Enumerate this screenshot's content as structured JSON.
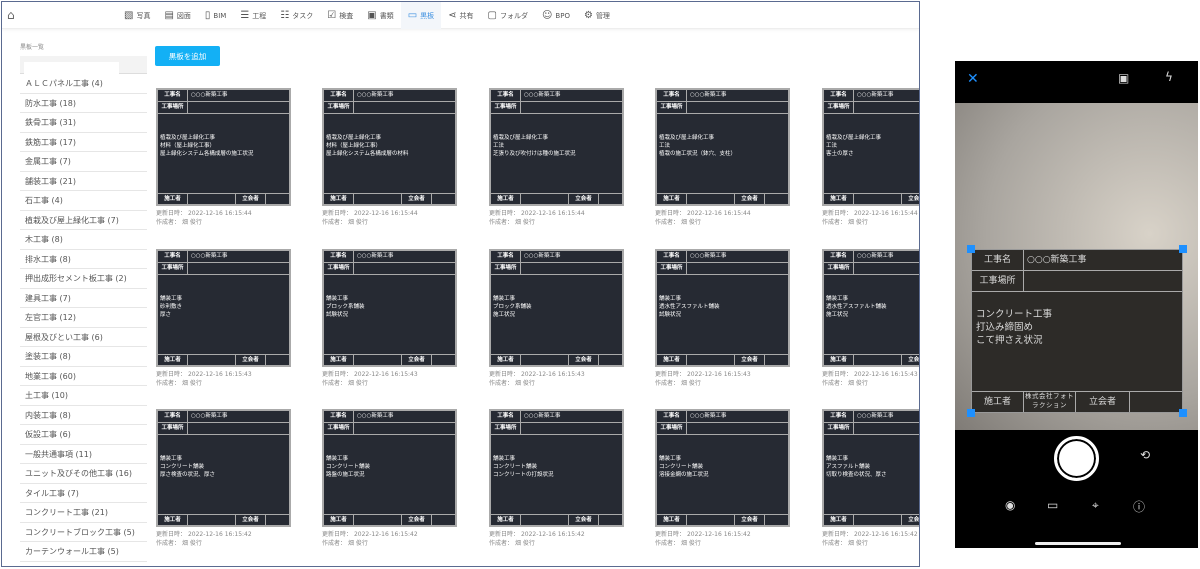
{
  "nav": {
    "home_icon": "home-icon",
    "items": [
      {
        "label": "写真",
        "icon": "image-icon"
      },
      {
        "label": "図面",
        "icon": "drawing-icon"
      },
      {
        "label": "BIM",
        "icon": "bim-icon"
      },
      {
        "label": "工程",
        "icon": "gantt-icon"
      },
      {
        "label": "タスク",
        "icon": "list-icon"
      },
      {
        "label": "検査",
        "icon": "clipboard-check-icon"
      },
      {
        "label": "書類",
        "icon": "document-icon"
      },
      {
        "label": "黒板",
        "icon": "board-icon",
        "active": true
      },
      {
        "label": "共有",
        "icon": "share-icon"
      },
      {
        "label": "フォルダ",
        "icon": "folder-icon"
      },
      {
        "label": "BPO",
        "icon": "users-icon"
      },
      {
        "label": "管理",
        "icon": "gear-icon"
      }
    ]
  },
  "sidebar": {
    "title": "黒板一覧",
    "search_value": "",
    "items": [
      "ＡＬＣパネル工事 (4)",
      "防水工事 (18)",
      "鉄骨工事 (31)",
      "鉄筋工事 (17)",
      "金属工事 (7)",
      "舗装工事 (21)",
      "石工事 (4)",
      "植栽及び屋上緑化工事 (7)",
      "木工事 (8)",
      "排水工事 (8)",
      "押出成形セメント板工事 (2)",
      "建具工事 (7)",
      "左官工事 (12)",
      "屋根及びとい工事 (6)",
      "塗装工事 (8)",
      "地業工事 (60)",
      "土工事 (10)",
      "内装工事 (8)",
      "仮設工事 (6)",
      "一般共通事項 (11)",
      "ユニット及びその他工事 (16)",
      "タイル工事 (7)",
      "コンクリート工事 (21)",
      "コンクリートブロック工事 (5)",
      "カーテンウォール工事 (5)"
    ]
  },
  "add_button": "黒板を追加",
  "board_labels": {
    "name": "工事名",
    "place": "工事場所",
    "builder": "施工者",
    "witness": "立会者",
    "updated": "更新日時：",
    "author": "作成者："
  },
  "cards": [
    {
      "name": "○○○新築工事",
      "lines": [
        "植栽及び屋上緑化工事",
        "材料（屋上緑化工事）",
        "屋上緑化システム各構成層の施工状況"
      ],
      "updated": "2022-12-16 16:15:44",
      "author": "畑 俊行"
    },
    {
      "name": "○○○新築工事",
      "lines": [
        "植栽及び屋上緑化工事",
        "材料（屋上緑化工事）",
        "屋上緑化システム各構成層の材料"
      ],
      "updated": "2022-12-16 16:15:44",
      "author": "畑 俊行"
    },
    {
      "name": "○○○新築工事",
      "lines": [
        "植栽及び屋上緑化工事",
        "工法",
        "芝張り及び吹付けは種の施工状況"
      ],
      "updated": "2022-12-16 16:15:44",
      "author": "畑 俊行"
    },
    {
      "name": "○○○新築工事",
      "lines": [
        "植栽及び屋上緑化工事",
        "工法",
        "植栽の施工状況（鉢穴、支柱）"
      ],
      "updated": "2022-12-16 16:15:44",
      "author": "畑 俊行"
    },
    {
      "name": "○○○新築工事",
      "lines": [
        "植栽及び屋上緑化工事",
        "工法",
        "客土の厚さ"
      ],
      "updated": "2022-12-16 16:15:44",
      "author": "畑 俊行"
    },
    {
      "name": "○○○新築工事",
      "lines": [
        "舗装工事",
        "砂利敷き",
        "厚さ"
      ],
      "updated": "2022-12-16 16:15:43",
      "author": "畑 俊行"
    },
    {
      "name": "○○○新築工事",
      "lines": [
        "舗装工事",
        "ブロック系舗装",
        "試験状況"
      ],
      "updated": "2022-12-16 16:15:43",
      "author": "畑 俊行"
    },
    {
      "name": "○○○新築工事",
      "lines": [
        "舗装工事",
        "ブロック系舗装",
        "施工状況"
      ],
      "updated": "2022-12-16 16:15:43",
      "author": "畑 俊行"
    },
    {
      "name": "○○○新築工事",
      "lines": [
        "舗装工事",
        "透水性アスファルト舗装",
        "試験状況"
      ],
      "updated": "2022-12-16 16:15:43",
      "author": "畑 俊行"
    },
    {
      "name": "○○○新築工事",
      "lines": [
        "舗装工事",
        "透水性アスファルト舗装",
        "施工状況"
      ],
      "updated": "2022-12-16 16:15:43",
      "author": "畑 俊行"
    },
    {
      "name": "○○○新築工事",
      "lines": [
        "舗装工事",
        "コンクリート舗装",
        "厚さ検査の状況、厚さ"
      ],
      "updated": "2022-12-16 16:15:42",
      "author": "畑 俊行"
    },
    {
      "name": "○○○新築工事",
      "lines": [
        "舗装工事",
        "コンクリート舗装",
        "路盤の施工状況"
      ],
      "updated": "2022-12-16 16:15:42",
      "author": "畑 俊行"
    },
    {
      "name": "○○○新築工事",
      "lines": [
        "舗装工事",
        "コンクリート舗装",
        "コンクリートの打設状況"
      ],
      "updated": "2022-12-16 16:15:42",
      "author": "畑 俊行"
    },
    {
      "name": "○○○新築工事",
      "lines": [
        "舗装工事",
        "コンクリート舗装",
        "溶接金網の施工状況"
      ],
      "updated": "2022-12-16 16:15:42",
      "author": "畑 俊行"
    },
    {
      "name": "○○○新築工事",
      "lines": [
        "舗装工事",
        "アスファルト舗装",
        "切取り検査の状況、厚さ"
      ],
      "updated": "2022-12-16 16:15:42",
      "author": "畑 俊行"
    }
  ],
  "phone": {
    "close_icon": "close-icon",
    "gallery_icon": "image-icon",
    "flash_icon": "flash-off-icon",
    "board": {
      "name_label": "工事名",
      "name": "○○○新築工事",
      "place_label": "工事場所",
      "lines": [
        "コンクリート工事",
        "打込み締固め",
        "こて押さえ状況"
      ],
      "builder_label": "施工者",
      "builder": "株式会社フォトラクション",
      "witness_label": "立会者"
    },
    "accent": "#1e90ff",
    "bottom_icons": [
      "eye-icon",
      "board-icon",
      "location-pin-icon",
      "info-icon"
    ],
    "switch_camera_icon": "switch-camera-icon"
  }
}
